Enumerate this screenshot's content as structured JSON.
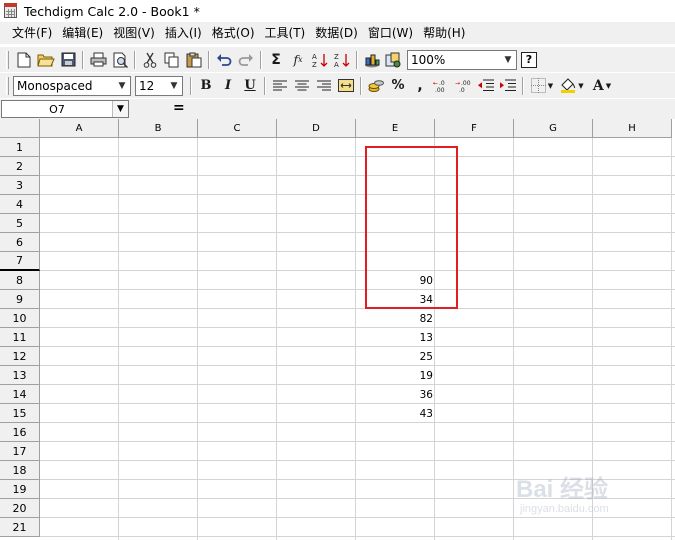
{
  "window": {
    "title": "Techdigm Calc 2.0 - Book1 *"
  },
  "menu": {
    "items": [
      "文件(F)",
      "编辑(E)",
      "视图(V)",
      "插入(I)",
      "格式(O)",
      "工具(T)",
      "数据(D)",
      "窗口(W)",
      "帮助(H)"
    ]
  },
  "toolbar1": {
    "zoom": "100%",
    "icons": [
      "new-file-icon",
      "open-folder-icon",
      "save-icon",
      "print-icon",
      "print-preview-icon",
      "cut-icon",
      "copy-icon",
      "paste-icon",
      "undo-icon",
      "redo-icon",
      "sum-icon",
      "function-icon",
      "sort-ascending-icon",
      "sort-descending-icon",
      "chart-icon",
      "image-icon",
      "help-icon"
    ]
  },
  "toolbar2": {
    "font": "Monospaced",
    "size": "12",
    "bold": "B",
    "italic": "I",
    "underline": "U",
    "percent": "%",
    "comma": ",",
    "font_color": "A"
  },
  "formula_bar": {
    "cell_ref": "O7",
    "equals": "="
  },
  "sheet": {
    "columns": [
      "A",
      "B",
      "C",
      "D",
      "E",
      "F",
      "G",
      "H"
    ],
    "rows": [
      "1",
      "2",
      "3",
      "4",
      "5",
      "6",
      "7",
      "8",
      "9",
      "10",
      "11",
      "12",
      "13",
      "14",
      "15",
      "16",
      "17",
      "18",
      "19",
      "20",
      "21"
    ],
    "active_row": "7",
    "cells": {
      "E8": "90",
      "E9": "34",
      "E10": "82",
      "E11": "13",
      "E12": "25",
      "E13": "19",
      "E14": "36",
      "E15": "43"
    },
    "highlight_range": "E8:E15",
    "highlight_color": "#e02020"
  },
  "watermark": {
    "logo": "Bai 经验",
    "url": "jingyan.baidu.com"
  }
}
